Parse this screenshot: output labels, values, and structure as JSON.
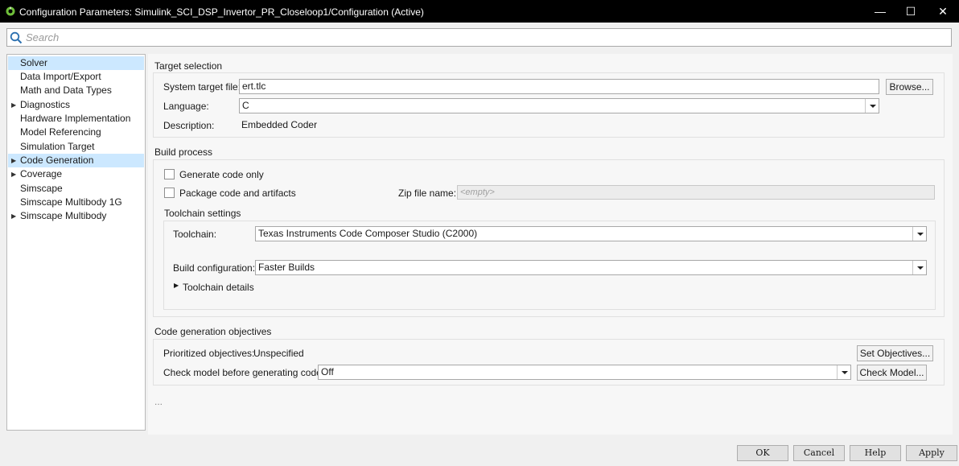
{
  "window": {
    "title": "Configuration Parameters: Simulink_SCI_DSP_Invertor_PR_Closeloop1/Configuration (Active)",
    "minimize": "—",
    "maximize": "☐",
    "close": "✕"
  },
  "search": {
    "placeholder": "Search"
  },
  "tree": {
    "items": [
      {
        "label": "Solver"
      },
      {
        "label": "Data Import/Export"
      },
      {
        "label": "Math and Data Types"
      },
      {
        "label": "Diagnostics"
      },
      {
        "label": "Hardware Implementation"
      },
      {
        "label": "Model Referencing"
      },
      {
        "label": "Simulation Target"
      },
      {
        "label": "Code Generation"
      },
      {
        "label": "Coverage"
      },
      {
        "label": "Simscape"
      },
      {
        "label": "Simscape Multibody 1G"
      },
      {
        "label": "Simscape Multibody"
      }
    ]
  },
  "target_selection": {
    "title": "Target selection",
    "system_target_file_label": "System target file:",
    "system_target_file_value": "ert.tlc",
    "browse_label": "Browse...",
    "language_label": "Language:",
    "language_value": "C",
    "description_label": "Description:",
    "description_value": "Embedded Coder"
  },
  "build_process": {
    "title": "Build process",
    "generate_code_only": "Generate code only",
    "package_code": "Package code and artifacts",
    "zip_file_label": "Zip file name:",
    "zip_file_placeholder": "<empty>",
    "toolchain_settings_title": "Toolchain settings",
    "toolchain_label": "Toolchain:",
    "toolchain_value": "Texas Instruments Code Composer Studio (C2000)",
    "build_config_label": "Build configuration:",
    "build_config_value": "Faster Builds",
    "toolchain_details": "Toolchain details"
  },
  "objectives": {
    "title": "Code generation objectives",
    "prioritized_label": "Prioritized objectives:",
    "prioritized_value": "Unspecified",
    "set_objectives_label": "Set Objectives...",
    "check_model_label": "Check model before generating code:",
    "check_model_value": "Off",
    "check_model_button": "Check Model..."
  },
  "more": "...",
  "footer": {
    "ok": "OK",
    "cancel": "Cancel",
    "help": "Help",
    "apply": "Apply"
  }
}
